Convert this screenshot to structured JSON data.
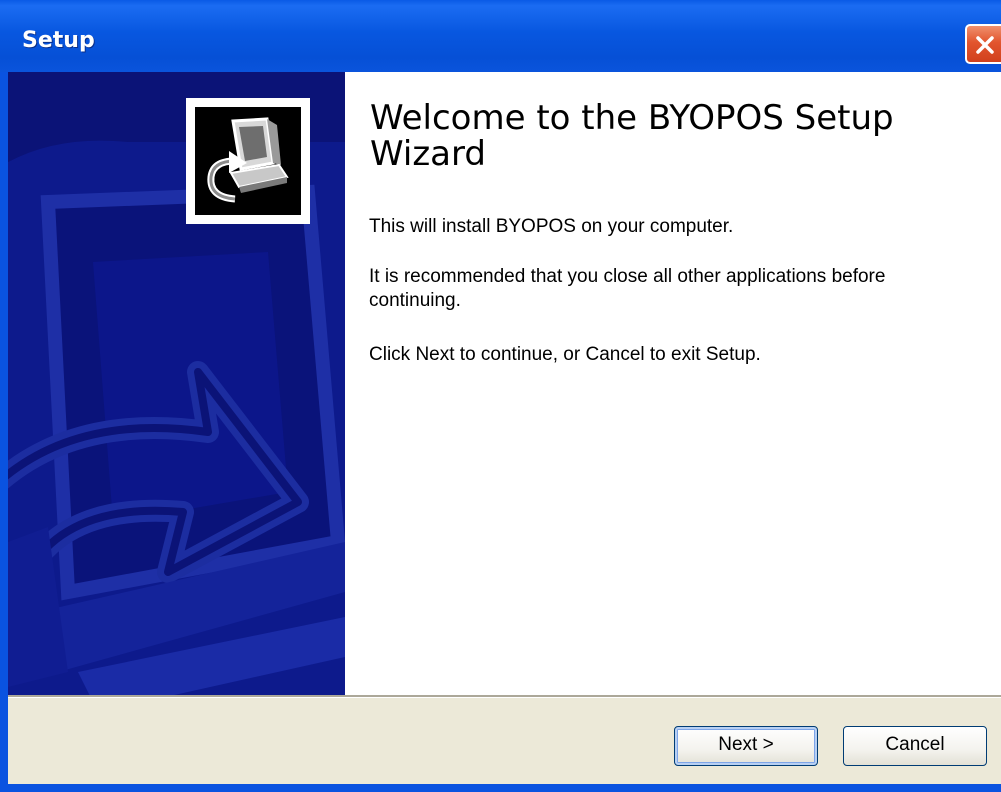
{
  "window": {
    "title": "Setup"
  },
  "wizard": {
    "heading": "Welcome to the BYOPOS Setup Wizard",
    "paragraph_1": "This will install BYOPOS on your computer.",
    "paragraph_2": "It is recommended that you close all other applications before continuing.",
    "paragraph_3": "Click Next to continue, or Cancel to exit Setup."
  },
  "buttons": {
    "next_label": "Next >",
    "cancel_label": "Cancel"
  },
  "icons": {
    "close": "close-icon",
    "installer_logo": "computer-install-icon"
  },
  "colors": {
    "titlebar": "#0a53e0",
    "banner": "#0b1377",
    "footer": "#ece9d8",
    "close_button": "#e2552e"
  }
}
